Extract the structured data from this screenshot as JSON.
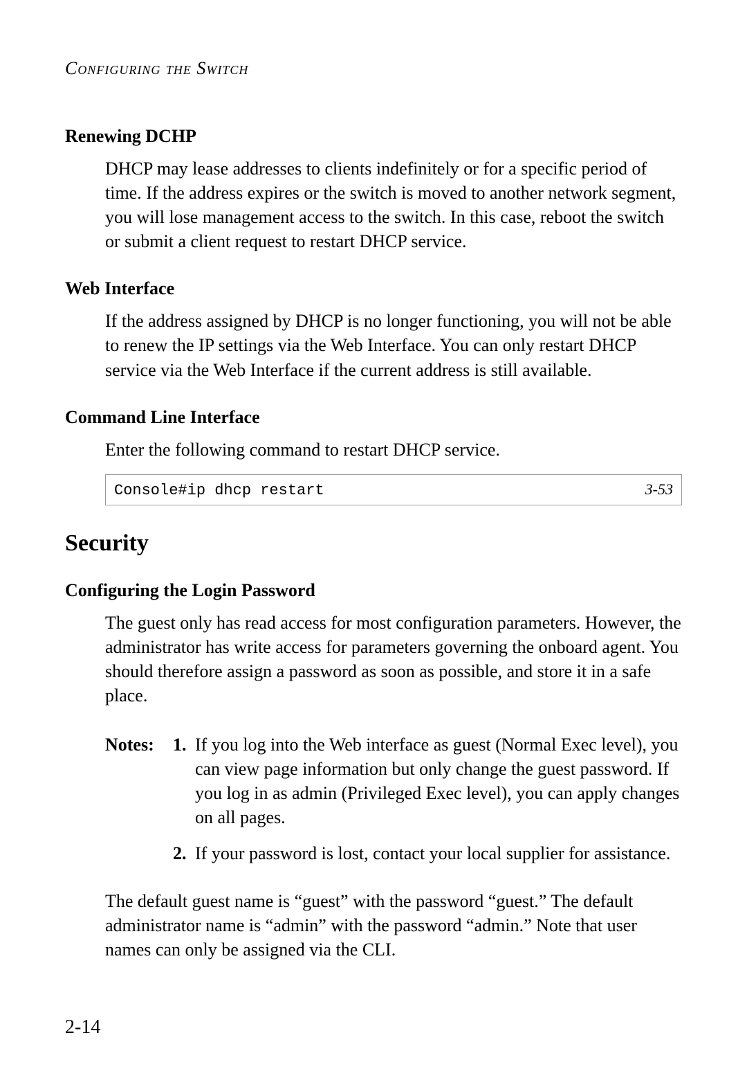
{
  "running_head": "Configuring the Switch",
  "renewing": {
    "title": "Renewing DCHP",
    "body": "DHCP may lease addresses to clients indefinitely or for a specific period of time. If the address expires or the switch is moved to another network segment, you will lose management access to the switch. In this case, reboot the switch or submit a client request to restart DHCP service."
  },
  "web_interface": {
    "title": "Web Interface",
    "body": "If the address assigned by DHCP is no longer functioning, you will not be able to renew the IP settings via the Web Interface. You can only restart DHCP service via the Web Interface if the current address is still available."
  },
  "cli": {
    "title": "Command Line Interface",
    "intro": "Enter the following command to restart DHCP service.",
    "cmd": "Console#ip dhcp restart",
    "ref": "3-53"
  },
  "security": {
    "title": "Security",
    "config_pw_title": "Configuring the Login Password",
    "body1": "The guest only has read access for most configuration parameters. However, the administrator has write access for parameters governing the onboard agent. You should therefore assign a password as soon as possible, and store it in a safe place.",
    "notes_label": "Notes:",
    "note1_num": "1.",
    "note1": "If you log into the Web interface as guest (Normal Exec level), you can view page information but only change the guest password. If you log in as admin (Privileged Exec level), you can apply changes on all pages.",
    "note2_num": "2.",
    "note2": "If your password is lost, contact your local supplier for assistance.",
    "body2": "The default guest name is “guest” with the password “guest.” The default administrator name is “admin” with the password “admin.” Note that user names can only be assigned via the CLI."
  },
  "page_number": "2-14"
}
